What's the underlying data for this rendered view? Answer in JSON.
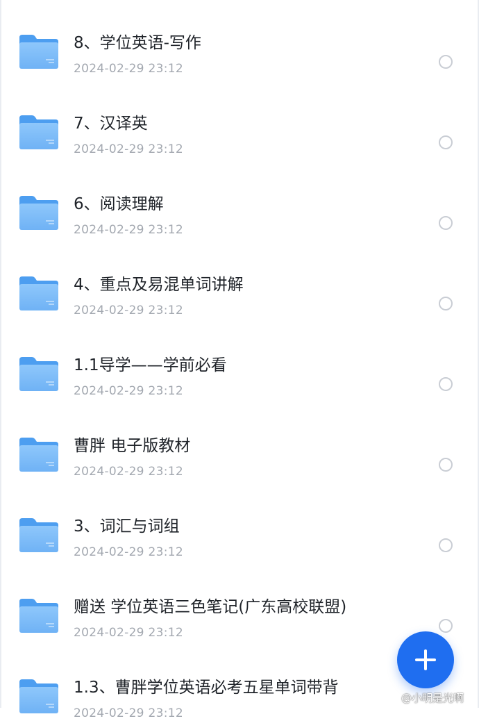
{
  "accent_color": "#1f6ef0",
  "folder_icon": "folder-icon",
  "files": [
    {
      "name": "8、学位英语-写作",
      "date": "2024-02-29 23:12"
    },
    {
      "name": "7、汉译英",
      "date": "2024-02-29 23:12"
    },
    {
      "name": "6、阅读理解",
      "date": "2024-02-29 23:12"
    },
    {
      "name": "4、重点及易混单词讲解",
      "date": "2024-02-29 23:12"
    },
    {
      "name": "1.1导学——学前必看",
      "date": "2024-02-29 23:12"
    },
    {
      "name": "曹胖 电子版教材",
      "date": "2024-02-29 23:12"
    },
    {
      "name": "3、词汇与词组",
      "date": "2024-02-29 23:12"
    },
    {
      "name": "赠送 学位英语三色笔记(广东高校联盟)",
      "date": "2024-02-29 23:12"
    },
    {
      "name": "1.3、曹胖学位英语必考五星单词带背",
      "date": "2024-02-29 23:12"
    }
  ],
  "fab": {
    "icon": "plus-icon"
  },
  "watermark": {
    "text": "@小明是光啊",
    "icon": "weibo-logo"
  }
}
